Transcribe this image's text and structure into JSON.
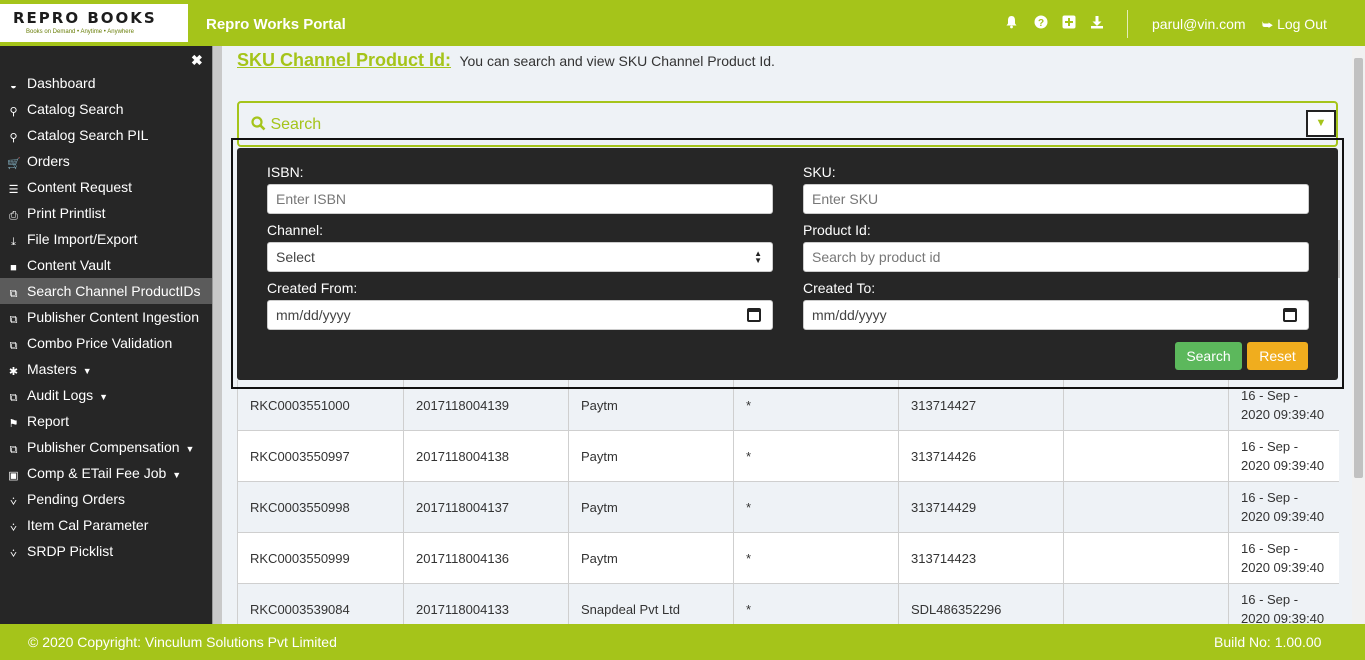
{
  "header": {
    "logo_text": "REPRO BOOKS",
    "logo_tagline": "Books on Demand • Anytime • Anywhere",
    "portal_title": "Repro Works Portal",
    "icons": [
      "bell-icon",
      "question-icon",
      "plus-square-icon",
      "download-icon"
    ],
    "user_email": "parul@vin.com",
    "logout_label": "Log Out"
  },
  "sidebar": {
    "items": [
      {
        "label": "Dashboard",
        "icon": "dashboard-icon",
        "caret": false
      },
      {
        "label": "Catalog Search",
        "icon": "search-icon",
        "caret": false
      },
      {
        "label": "Catalog Search PIL",
        "icon": "search-icon",
        "caret": false
      },
      {
        "label": "Orders",
        "icon": "cart-icon",
        "caret": false
      },
      {
        "label": "Content Request",
        "icon": "list-icon",
        "caret": false
      },
      {
        "label": "Print Printlist",
        "icon": "print-icon",
        "caret": false
      },
      {
        "label": "File Import/Export",
        "icon": "download-icon",
        "caret": false
      },
      {
        "label": "Content Vault",
        "icon": "folder-icon",
        "caret": false
      },
      {
        "label": "Search Channel ProductIDs",
        "icon": "copy-icon",
        "caret": false,
        "active": true
      },
      {
        "label": "Publisher Content Ingestion",
        "icon": "copy-icon",
        "caret": false
      },
      {
        "label": "Combo Price Validation",
        "icon": "copy-icon",
        "caret": false
      },
      {
        "label": "Masters",
        "icon": "asterisk-icon",
        "caret": true
      },
      {
        "label": "Audit Logs",
        "icon": "copy-icon",
        "caret": true
      },
      {
        "label": "Report",
        "icon": "flag-icon",
        "caret": false
      },
      {
        "label": "Publisher Compensation",
        "icon": "copy-icon",
        "caret": true
      },
      {
        "label": "Comp & ETail Fee Job",
        "icon": "money-icon",
        "caret": true
      },
      {
        "label": "Pending Orders",
        "icon": "cart-plus-icon",
        "caret": false
      },
      {
        "label": "Item Cal Parameter",
        "icon": "cart-plus-icon",
        "caret": false
      },
      {
        "label": "SRDP Picklist",
        "icon": "cart-plus-icon",
        "caret": false
      }
    ]
  },
  "page": {
    "title": "SKU Channel Product Id:",
    "description": "You can search and view SKU Channel Product Id."
  },
  "search": {
    "label": "Search",
    "isbn_label": "ISBN:",
    "isbn_placeholder": "Enter ISBN",
    "sku_label": "SKU:",
    "sku_placeholder": "Enter SKU",
    "channel_label": "Channel:",
    "channel_value": "Select",
    "product_label": "Product Id:",
    "product_placeholder": "Search by product id",
    "from_label": "Created From:",
    "from_value": "mm/dd/yyyy",
    "to_label": "Created To:",
    "to_value": "mm/dd/yyyy",
    "search_button": "Search",
    "reset_button": "Reset"
  },
  "table": {
    "rows": [
      {
        "sku": "RKC0003551000",
        "isbn": "2017118004139",
        "channel": "Paytm",
        "flag": "*",
        "product_id": "313714427",
        "extra": "",
        "date_line1": "16 - Sep -",
        "date_line2": "2020 09:39:40"
      },
      {
        "sku": "RKC0003550997",
        "isbn": "2017118004138",
        "channel": "Paytm",
        "flag": "*",
        "product_id": "313714426",
        "extra": "",
        "date_line1": "16 - Sep -",
        "date_line2": "2020 09:39:40"
      },
      {
        "sku": "RKC0003550998",
        "isbn": "2017118004137",
        "channel": "Paytm",
        "flag": "*",
        "product_id": "313714429",
        "extra": "",
        "date_line1": "16 - Sep -",
        "date_line2": "2020 09:39:40"
      },
      {
        "sku": "RKC0003550999",
        "isbn": "2017118004136",
        "channel": "Paytm",
        "flag": "*",
        "product_id": "313714423",
        "extra": "",
        "date_line1": "16 - Sep -",
        "date_line2": "2020 09:39:40"
      },
      {
        "sku": "RKC0003539084",
        "isbn": "2017118004133",
        "channel": "Snapdeal Pvt Ltd",
        "flag": "*",
        "product_id": "SDL486352296",
        "extra": "",
        "date_line1": "16 - Sep -",
        "date_line2": "2020 09:39:40"
      }
    ]
  },
  "footer": {
    "copyright": "© 2020 Copyright: Vinculum Solutions Pvt Limited",
    "build": "Build No: 1.00.00"
  },
  "colors": {
    "brand": "#a5c41a",
    "sidebar": "#262626",
    "search_button": "#5cb85c",
    "reset_button": "#f0ad1e"
  }
}
